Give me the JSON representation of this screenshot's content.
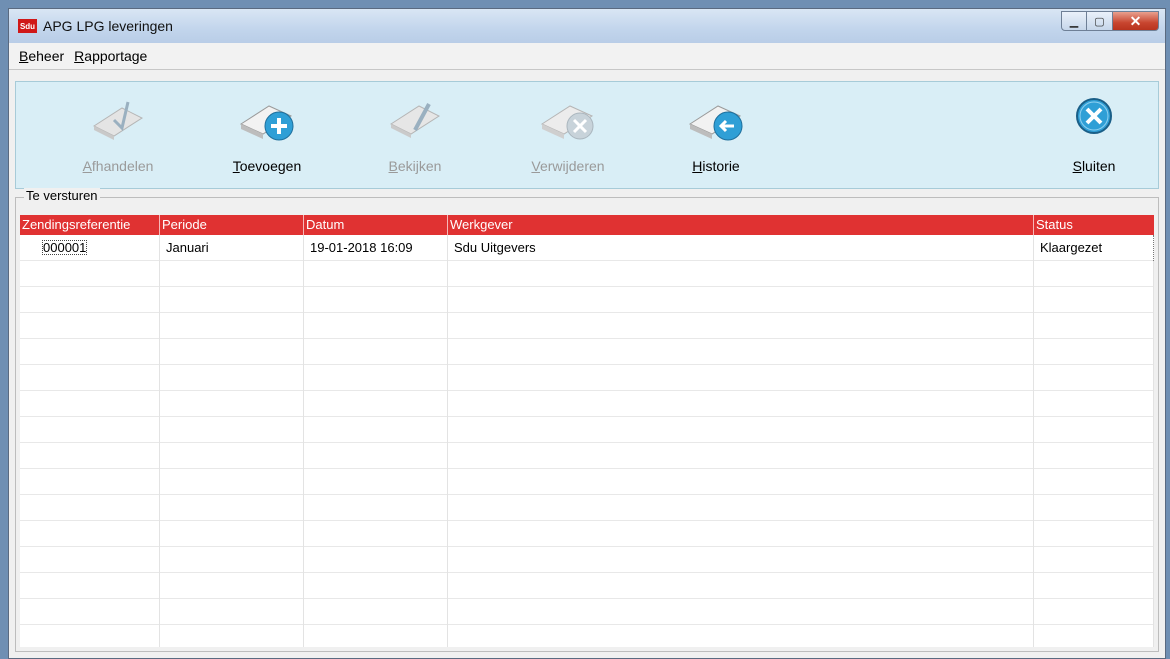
{
  "window": {
    "title": "APG LPG leveringen",
    "icon_text": "Sdu",
    "controls": {
      "minimize": "▁",
      "maximize": "▢",
      "close": "✕"
    }
  },
  "menu": {
    "items": [
      {
        "label": "Beheer",
        "accel": "B",
        "rest": "eheer"
      },
      {
        "label": "Rapportage",
        "accel": "R",
        "rest": "apportage"
      }
    ]
  },
  "toolbar": {
    "buttons": [
      {
        "label": "Afhandelen",
        "accel": "A",
        "rest": "fhandelen",
        "icon": "check-document-icon",
        "enabled": false
      },
      {
        "label": "Toevoegen",
        "accel": "T",
        "rest": "oevoegen",
        "icon": "add-document-icon",
        "enabled": true
      },
      {
        "label": "Bekijken",
        "accel": "B",
        "rest": "ekijken",
        "icon": "view-document-icon",
        "enabled": false
      },
      {
        "label": "Verwijderen",
        "accel": "V",
        "rest": "erwijderen",
        "icon": "delete-document-icon",
        "enabled": false
      },
      {
        "label": "Historie",
        "accel": "H",
        "rest": "istorie",
        "icon": "history-document-icon",
        "enabled": true
      },
      {
        "label": "Sluiten",
        "accel": "S",
        "rest": "luiten",
        "icon": "close-circle-icon",
        "enabled": true
      }
    ]
  },
  "group": {
    "title": "Te versturen"
  },
  "table": {
    "columns": [
      "Zendingsreferentie",
      "Periode",
      "Datum",
      "Werkgever",
      "Status"
    ],
    "rows": [
      [
        "000001",
        "Januari",
        "19-01-2018 16:09",
        "Sdu Uitgevers",
        "Klaargezet"
      ]
    ]
  },
  "colors": {
    "header": "#e03232",
    "toolbar": "#d9eef6",
    "accent_icon": "#2f9fd6"
  }
}
